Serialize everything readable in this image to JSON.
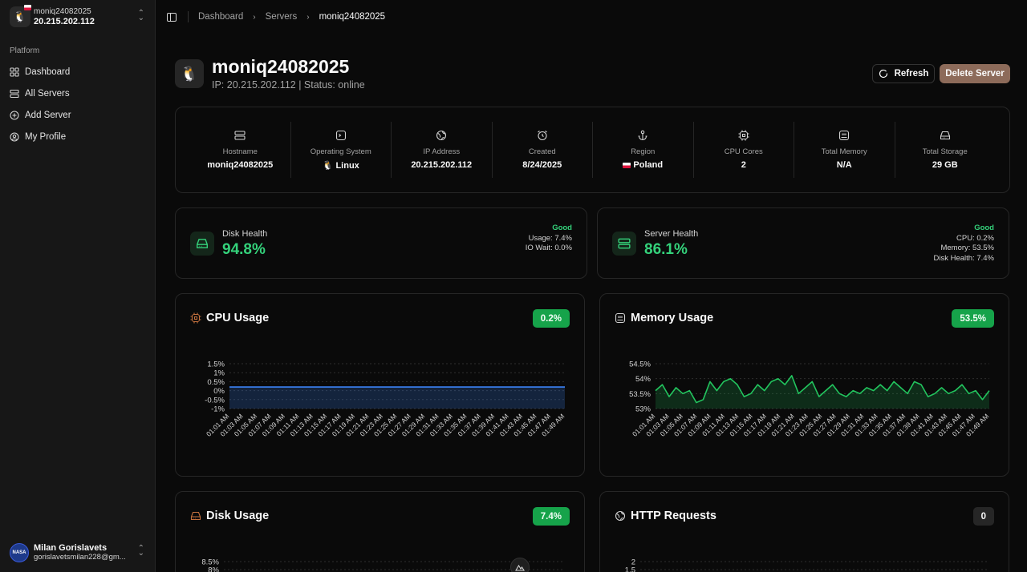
{
  "sidebar": {
    "server_name": "moniq24082025",
    "server_ip": "20.215.202.112",
    "group_label": "Platform",
    "items": [
      {
        "label": "Dashboard",
        "icon": "grid-icon"
      },
      {
        "label": "All Servers",
        "icon": "server-list-icon"
      },
      {
        "label": "Add Server",
        "icon": "plus-circle-icon"
      },
      {
        "label": "My Profile",
        "icon": "user-circle-icon"
      }
    ],
    "user": {
      "name": "Milan Gorislavets",
      "email": "gorislavetsmilan228@gm...",
      "avatar_text": "NASA"
    }
  },
  "breadcrumb": [
    "Dashboard",
    "Servers",
    "moniq24082025"
  ],
  "header": {
    "title": "moniq24082025",
    "subtitle": "IP: 20.215.202.112 | Status: online",
    "refresh_label": "Refresh",
    "delete_label": "Delete Server"
  },
  "info": [
    {
      "label": "Hostname",
      "value": "moniq24082025",
      "icon": "server-icon"
    },
    {
      "label": "Operating System",
      "value": "🐧 Linux",
      "icon": "terminal-icon"
    },
    {
      "label": "IP Address",
      "value": "20.215.202.112",
      "icon": "globe-icon"
    },
    {
      "label": "Created",
      "value": "8/24/2025",
      "icon": "alarm-clock-icon"
    },
    {
      "label": "Region",
      "value": "Poland",
      "icon": "anchor-icon"
    },
    {
      "label": "CPU Cores",
      "value": "2",
      "icon": "cpu-icon"
    },
    {
      "label": "Total Memory",
      "value": "N/A",
      "icon": "memory-icon"
    },
    {
      "label": "Total Storage",
      "value": "29 GB",
      "icon": "hard-drive-icon"
    }
  ],
  "health": {
    "disk": {
      "title": "Disk Health",
      "value": "94.8%",
      "status": "Good",
      "lines": [
        "Usage: 7.4%",
        "IO Wait: 0.0%"
      ]
    },
    "server": {
      "title": "Server Health",
      "value": "86.1%",
      "status": "Good",
      "lines": [
        "CPU: 0.2%",
        "Memory: 53.5%",
        "Disk Health: 7.4%"
      ]
    }
  },
  "charts": {
    "cpu": {
      "title": "CPU Usage",
      "badge": "0.2%"
    },
    "memory": {
      "title": "Memory Usage",
      "badge": "53.5%"
    },
    "disk": {
      "title": "Disk Usage",
      "badge": "7.4%"
    },
    "http": {
      "title": "HTTP Requests",
      "badge": "0"
    }
  },
  "colors": {
    "accent_green": "#16a34a",
    "health_green": "#34d27b",
    "cpu_line": "#3b82f6",
    "memory_line": "#22c55e",
    "delete_button": "#8d6b5a"
  },
  "chart_data": [
    {
      "type": "area",
      "title": "CPU Usage",
      "x": [
        "01:01 AM",
        "01:03 AM",
        "01:05 AM",
        "01:07 AM",
        "01:09 AM",
        "01:11 AM",
        "01:13 AM",
        "01:15 AM",
        "01:17 AM",
        "01:19 AM",
        "01:21 AM",
        "01:23 AM",
        "01:25 AM",
        "01:27 AM",
        "01:29 AM",
        "01:31 AM",
        "01:33 AM",
        "01:35 AM",
        "01:37 AM",
        "01:39 AM",
        "01:41 AM",
        "01:43 AM",
        "01:45 AM",
        "01:47 AM",
        "01:49 AM"
      ],
      "yticks": [
        "1.5%",
        "1%",
        "0.5%",
        "0%",
        "-0.5%",
        "-1%"
      ],
      "ylim": [
        -1,
        1.5
      ],
      "values": [
        0.2,
        0.2,
        0.2,
        0.2,
        0.2,
        0.2,
        0.2,
        0.2,
        0.2,
        0.2,
        0.2,
        0.2,
        0.2,
        0.2,
        0.2,
        0.2,
        0.2,
        0.2,
        0.2,
        0.2,
        0.2,
        0.2,
        0.2,
        0.2,
        0.2
      ]
    },
    {
      "type": "area",
      "title": "Memory Usage",
      "x": [
        "01:01 AM",
        "01:03 AM",
        "01:05 AM",
        "01:07 AM",
        "01:09 AM",
        "01:11 AM",
        "01:13 AM",
        "01:15 AM",
        "01:17 AM",
        "01:19 AM",
        "01:21 AM",
        "01:23 AM",
        "01:25 AM",
        "01:27 AM",
        "01:29 AM",
        "01:31 AM",
        "01:33 AM",
        "01:35 AM",
        "01:37 AM",
        "01:39 AM",
        "01:41 AM",
        "01:43 AM",
        "01:45 AM",
        "01:47 AM",
        "01:49 AM"
      ],
      "yticks": [
        "54.5%",
        "54%",
        "53.5%",
        "53%"
      ],
      "ylim": [
        53,
        54.5
      ],
      "values": [
        53.6,
        53.8,
        53.4,
        53.7,
        53.5,
        53.6,
        53.2,
        53.3,
        53.9,
        53.6,
        53.9,
        54.0,
        53.8,
        53.4,
        53.5,
        53.8,
        53.6,
        53.9,
        54.0,
        53.8,
        54.1,
        53.5,
        53.7,
        53.9,
        53.4,
        53.6,
        53.8,
        53.5,
        53.4,
        53.6,
        53.5,
        53.7,
        53.6,
        53.8,
        53.6,
        53.9,
        53.7,
        53.5,
        53.9,
        53.8,
        53.4,
        53.5,
        53.7,
        53.5,
        53.6,
        53.8,
        53.5,
        53.6,
        53.3,
        53.6
      ]
    },
    {
      "type": "area",
      "title": "Disk Usage",
      "yticks": [
        "8.5%",
        "8%"
      ]
    },
    {
      "type": "area",
      "title": "HTTP Requests",
      "yticks": [
        "2",
        "1.5"
      ]
    }
  ]
}
